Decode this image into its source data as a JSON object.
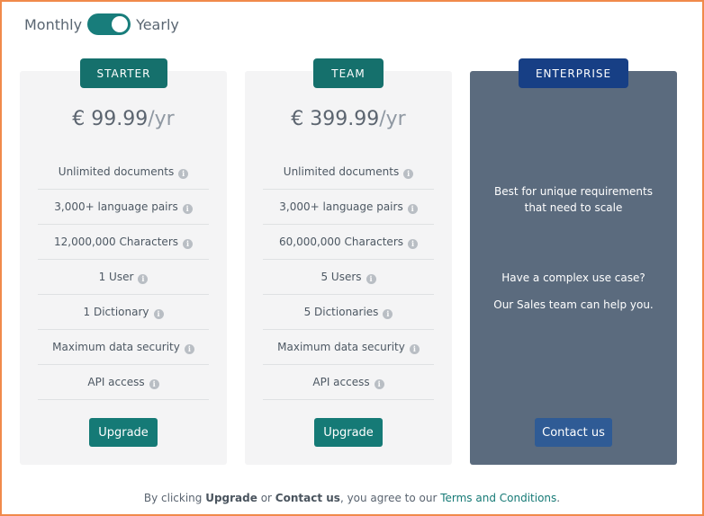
{
  "billing": {
    "monthly_label": "Monthly",
    "yearly_label": "Yearly",
    "yearly_selected": true
  },
  "plans": {
    "starter": {
      "name": "STARTER",
      "price": "€ 99.99",
      "period": "/yr",
      "features": [
        "Unlimited documents",
        "3,000+ language pairs",
        "12,000,000 Characters",
        "1 User",
        "1 Dictionary",
        "Maximum data security",
        "API access"
      ],
      "cta": "Upgrade"
    },
    "team": {
      "name": "TEAM",
      "price": "€ 399.99",
      "period": "/yr",
      "features": [
        "Unlimited documents",
        "3,000+ language pairs",
        "60,000,000 Characters",
        "5 Users",
        "5 Dictionaries",
        "Maximum data security",
        "API access"
      ],
      "cta": "Upgrade"
    },
    "enterprise": {
      "name": "ENTERPRISE",
      "description_line1": "Best for unique requirements",
      "description_line2": "that need to scale",
      "question": "Have a complex use case?",
      "help": "Our Sales team can help you.",
      "cta": "Contact us"
    }
  },
  "legal": {
    "prefix": "By clicking ",
    "upgrade": "Upgrade",
    "or": " or ",
    "contact": "Contact us",
    "middle": ", you agree to our ",
    "terms_link": "Terms and Conditions",
    "suffix": "."
  },
  "colors": {
    "accent": "#15706c",
    "enterprise_bg": "#5b6b7e",
    "enterprise_badge": "#173f85",
    "contact_button": "#2f5b95",
    "frame": "#f08a4b"
  },
  "icons": {
    "feature_info": "info-icon"
  }
}
